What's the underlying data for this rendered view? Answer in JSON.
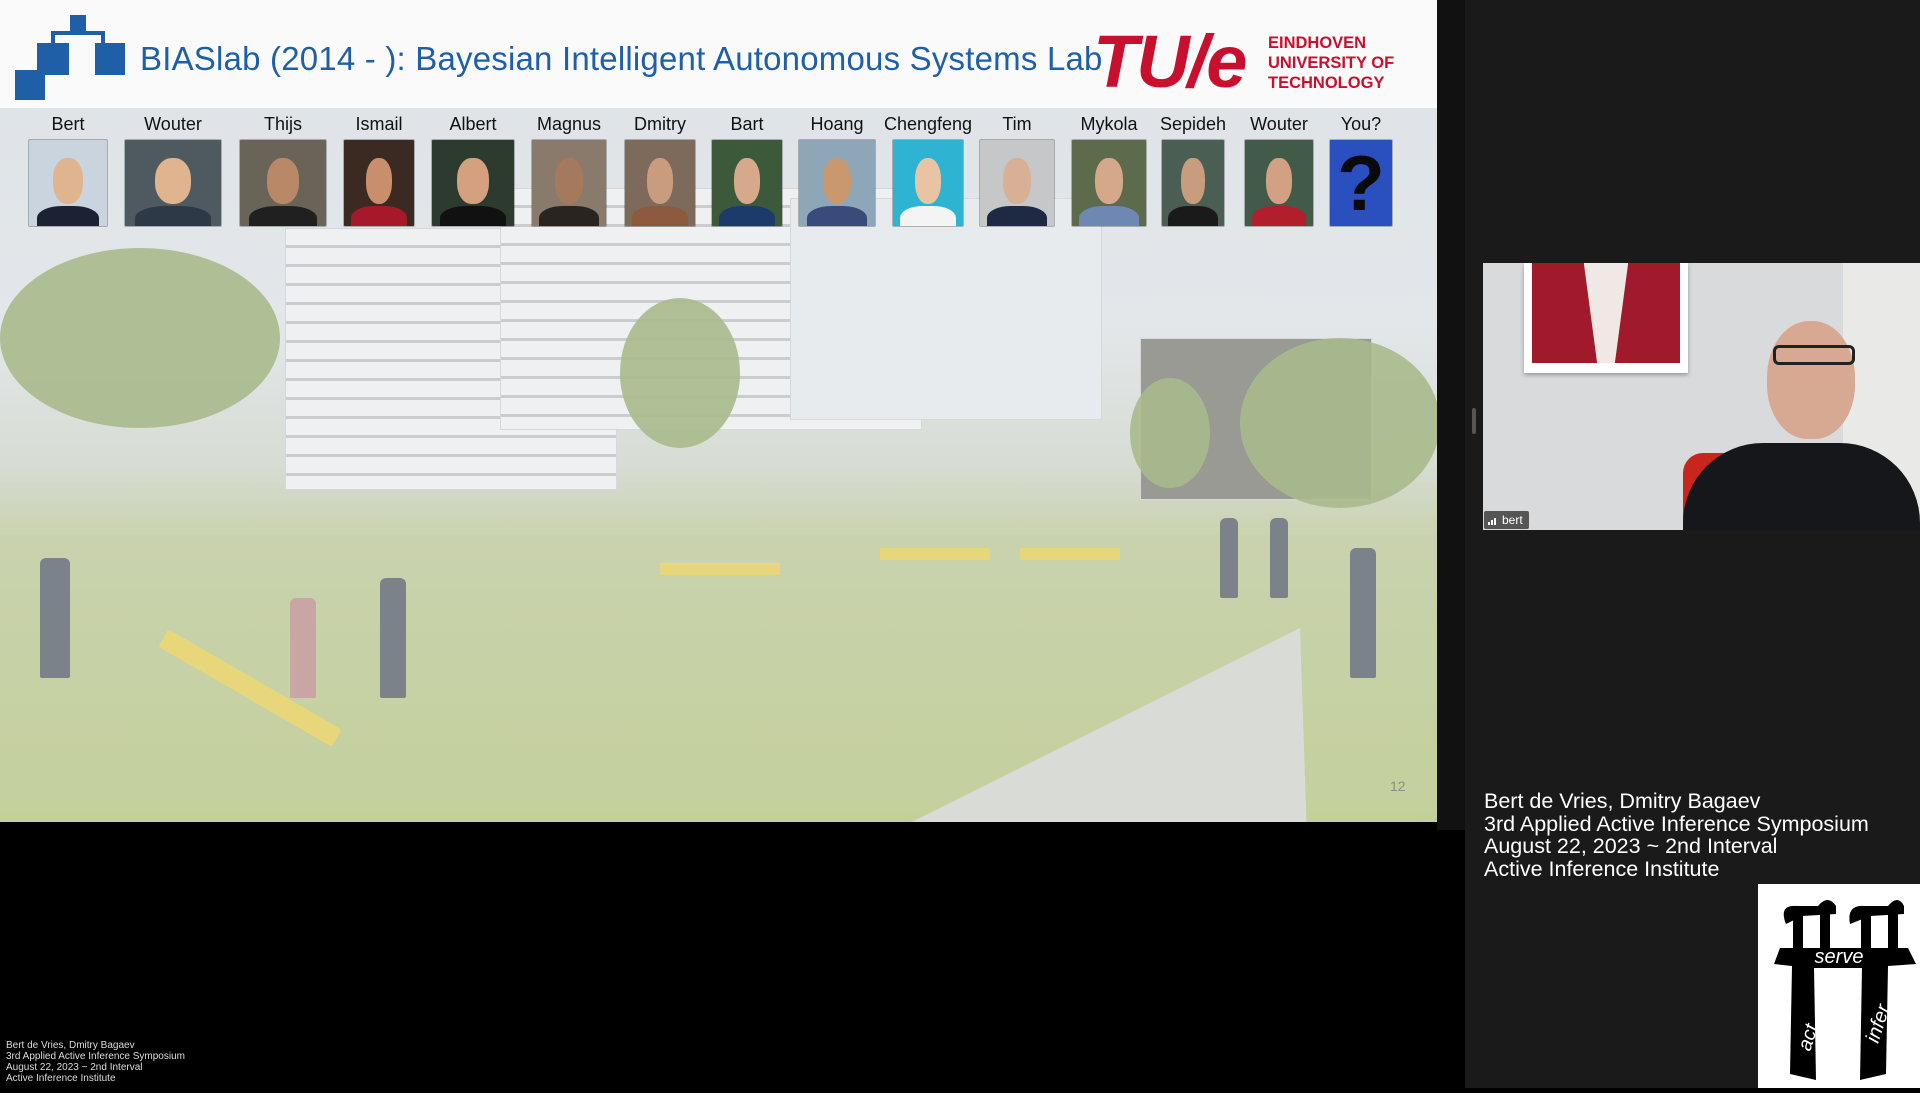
{
  "slide": {
    "title": "BIASlab (2014 - ): Bayesian Intelligent Autonomous Systems Lab",
    "university_logo_text": "TU/e",
    "university_name_lines": [
      "EINDHOVEN",
      "UNIVERSITY OF",
      "TECHNOLOGY"
    ],
    "slide_number": "12",
    "members": [
      {
        "name": "Bert"
      },
      {
        "name": "Wouter"
      },
      {
        "name": "Thijs"
      },
      {
        "name": "Ismail"
      },
      {
        "name": "Albert"
      },
      {
        "name": "Magnus"
      },
      {
        "name": "Dmitry"
      },
      {
        "name": "Bart"
      },
      {
        "name": "Hoang"
      },
      {
        "name": "Chengfeng"
      },
      {
        "name": "Tim"
      },
      {
        "name": "Mykola"
      },
      {
        "name": "Sepideh"
      },
      {
        "name": "Wouter"
      },
      {
        "name": "You?"
      }
    ],
    "unknown_member_mark": "?"
  },
  "video": {
    "participant_name": "bert"
  },
  "info": {
    "lines": [
      "Bert de Vries, Dmitry Bagaev",
      "3rd Applied Active Inference Symposium",
      "August 22, 2023 ~ 2nd Interval",
      "Active Inference Institute"
    ]
  },
  "logo": {
    "top_word": "serve",
    "left_word": "act",
    "right_word": "infer"
  },
  "colors": {
    "title_blue": "#1f5fa8",
    "tue_red": "#c8102e",
    "background": "#000000"
  }
}
